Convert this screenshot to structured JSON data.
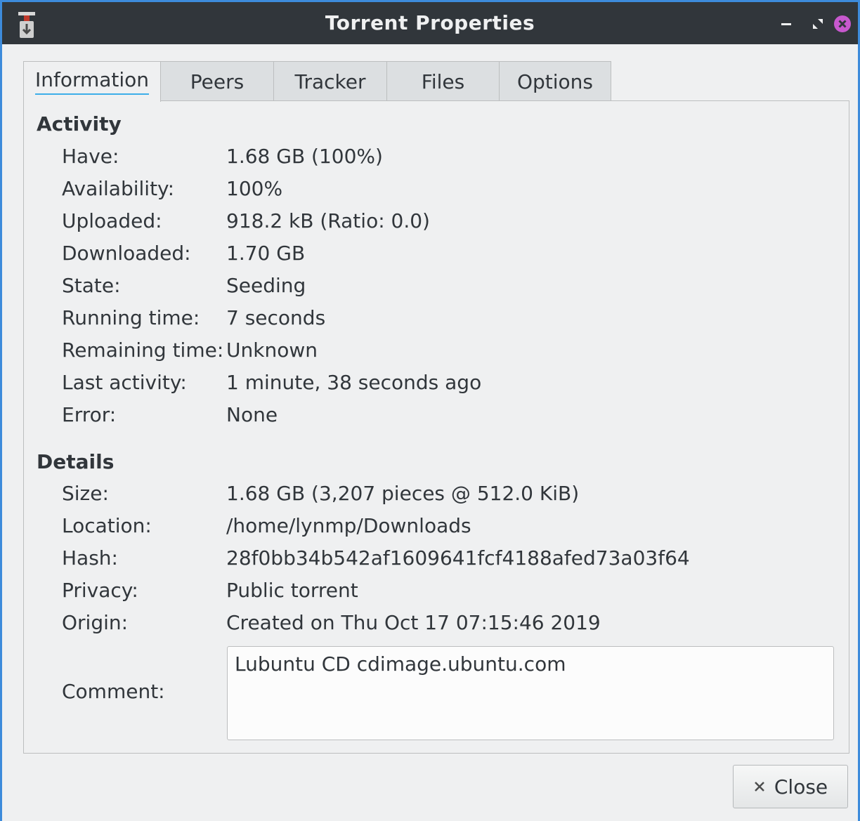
{
  "window": {
    "title": "Torrent Properties"
  },
  "tabs": [
    {
      "label": "Information"
    },
    {
      "label": "Peers"
    },
    {
      "label": "Tracker"
    },
    {
      "label": "Files"
    },
    {
      "label": "Options"
    }
  ],
  "activity": {
    "heading": "Activity",
    "rows": [
      {
        "label": "Have:",
        "value": "1.68 GB (100%)"
      },
      {
        "label": "Availability:",
        "value": "100%"
      },
      {
        "label": "Uploaded:",
        "value": "918.2 kB (Ratio: 0.0)"
      },
      {
        "label": "Downloaded:",
        "value": "1.70 GB"
      },
      {
        "label": "State:",
        "value": "Seeding"
      },
      {
        "label": "Running time:",
        "value": "7 seconds"
      },
      {
        "label": "Remaining time:",
        "value": "Unknown"
      },
      {
        "label": "Last activity:",
        "value": "1 minute, 38 seconds ago"
      },
      {
        "label": "Error:",
        "value": "None"
      }
    ]
  },
  "details": {
    "heading": "Details",
    "rows": [
      {
        "label": "Size:",
        "value": "1.68 GB (3,207 pieces @ 512.0 KiB)"
      },
      {
        "label": "Location:",
        "value": "/home/lynmp/Downloads"
      },
      {
        "label": "Hash:",
        "value": "28f0bb34b542af1609641fcf4188afed73a03f64"
      },
      {
        "label": "Privacy:",
        "value": "Public torrent"
      },
      {
        "label": "Origin:",
        "value": "Created on Thu Oct 17 07:15:46 2019"
      }
    ],
    "comment_label": "Comment:",
    "comment_value": "Lubuntu CD cdimage.ubuntu.com"
  },
  "buttons": {
    "close_label": "Close"
  },
  "colors": {
    "titlebar": "#31363b",
    "accent": "#3daee9",
    "close_icon": "#c758ce"
  }
}
